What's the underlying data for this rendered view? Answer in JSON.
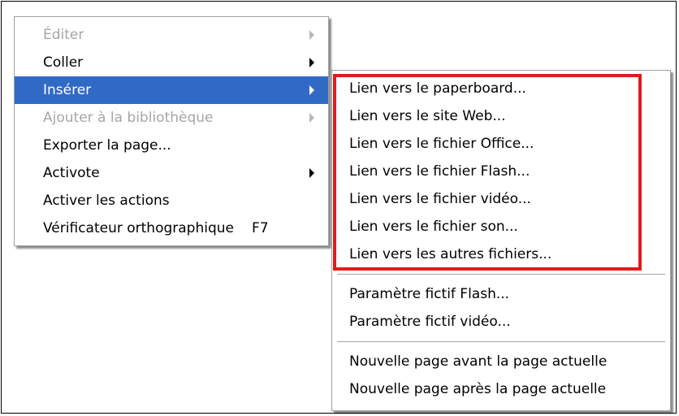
{
  "main_menu": {
    "items": [
      {
        "label": "Éditer",
        "disabled": true,
        "submenu": true
      },
      {
        "label": "Coller",
        "disabled": false,
        "submenu": true
      },
      {
        "label": "Insérer",
        "disabled": false,
        "submenu": true,
        "highlighted": true
      },
      {
        "label": "Ajouter à la bibliothèque",
        "disabled": true,
        "submenu": true
      },
      {
        "label": "Exporter la page...",
        "disabled": false,
        "submenu": false
      },
      {
        "label": "Activote",
        "disabled": false,
        "submenu": true
      },
      {
        "label": "Activer les actions",
        "disabled": false,
        "submenu": false
      },
      {
        "label": "Vérificateur orthographique",
        "shortcut": "F7",
        "disabled": false,
        "submenu": false
      }
    ]
  },
  "sub_menu": {
    "link_items": [
      "Lien vers le paperboard...",
      "Lien vers le site Web...",
      "Lien vers le fichier Office...",
      "Lien vers le fichier Flash...",
      "Lien vers le fichier vidéo...",
      "Lien vers le fichier son...",
      "Lien vers les autres fichiers..."
    ],
    "placeholder_items": [
      "Paramètre fictif Flash...",
      "Paramètre fictif vidéo..."
    ],
    "page_items": [
      "Nouvelle page avant la page actuelle",
      "Nouvelle page après la page actuelle"
    ]
  },
  "colors": {
    "highlight": "#316ac5",
    "annotation_box": "#e11b1b",
    "disabled_text": "#a6a6a6"
  }
}
